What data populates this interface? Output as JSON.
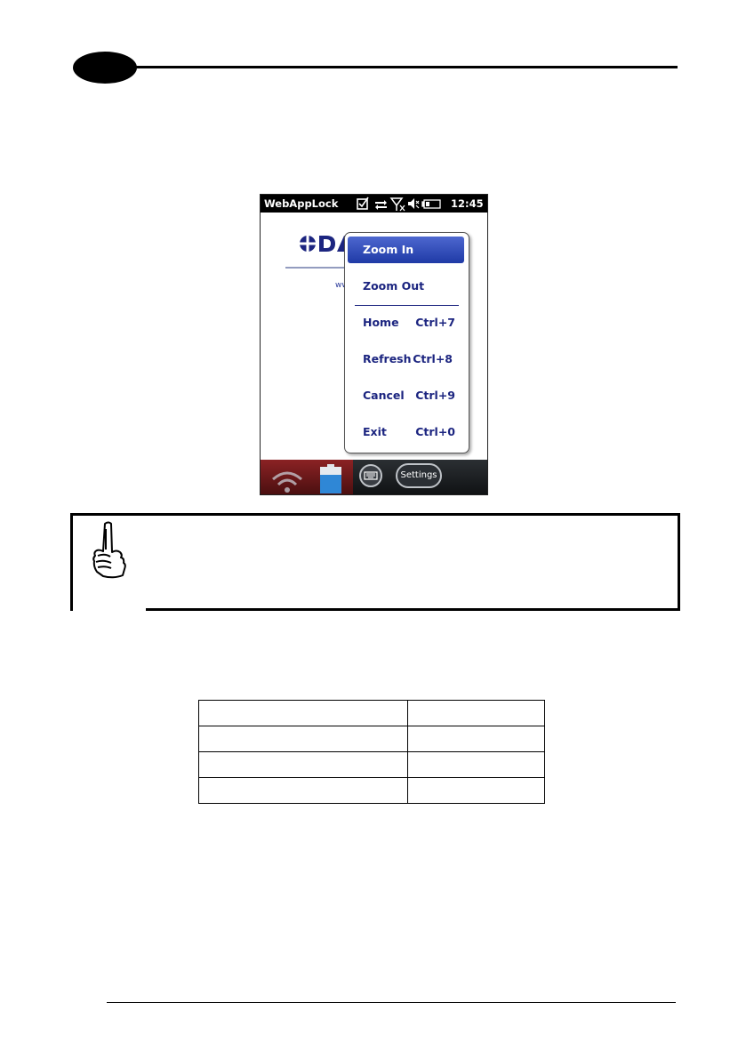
{
  "device": {
    "app_title": "WebAppLock",
    "time": "12:45",
    "status_icons": [
      "checkbox-icon",
      "sync-arrows-icon",
      "no-signal-icon",
      "speaker-muted-icon",
      "battery-icon"
    ]
  },
  "menu": {
    "items": [
      {
        "label": "Zoom In",
        "shortcut": ""
      },
      {
        "label": "Zoom Out",
        "shortcut": ""
      },
      {
        "label": "Home",
        "shortcut": "Ctrl+7"
      },
      {
        "label": "Refresh",
        "shortcut": "Ctrl+8"
      },
      {
        "label": "Cancel",
        "shortcut": "Ctrl+9"
      },
      {
        "label": "Exit",
        "shortcut": "Ctrl+0"
      }
    ],
    "selected": "Zoom In"
  },
  "taskbar": {
    "settings_label": "Settings"
  },
  "table": {
    "rows": [
      [
        "",
        ""
      ],
      [
        "",
        ""
      ],
      [
        "",
        ""
      ],
      [
        "",
        ""
      ]
    ]
  },
  "colors": {
    "menu_text": "#1c2580",
    "menu_selected": "#2a46b5",
    "taskbar_left": "#7a1c1e"
  }
}
